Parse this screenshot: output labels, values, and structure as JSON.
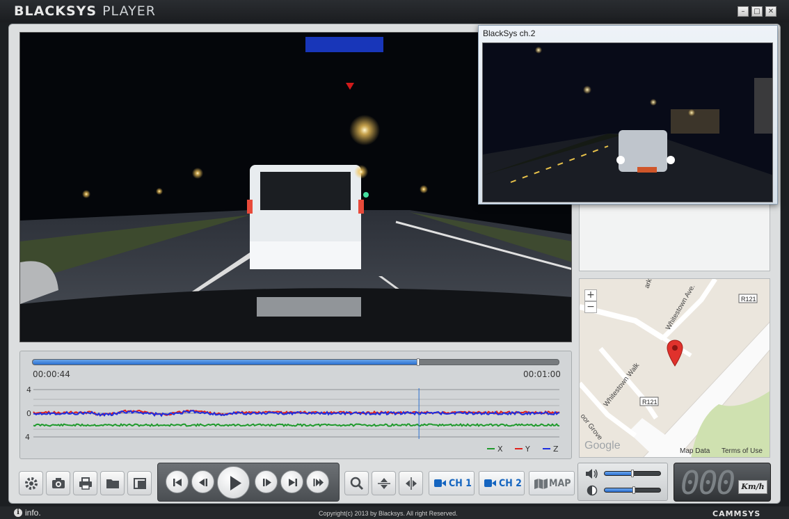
{
  "app": {
    "title_bold": "BLACKSYS",
    "title_light": "PLAYER",
    "window_controls": {
      "minimize": "–",
      "maximize": "□",
      "close": "✕"
    }
  },
  "ch2_window": {
    "title": "BlackSys ch.2"
  },
  "map": {
    "zoom_in": "+",
    "zoom_out": "−",
    "labels": [
      "Whitestown Ave.",
      "Whitestown Walk",
      "R121",
      "R121",
      "ark",
      "oor Grove"
    ],
    "logo": "Google",
    "map_data": "Map Data",
    "terms": "Terms of Use",
    "pin_color": "#e0322c"
  },
  "playback": {
    "current_time": "00:00:44",
    "total_time": "00:01:00",
    "progress": 0.733
  },
  "gsensor": {
    "y_ticks": [
      "4",
      "0",
      "-4"
    ],
    "legend": [
      {
        "name": "X",
        "color": "#1f9a2c"
      },
      {
        "name": "Y",
        "color": "#e0201c"
      },
      {
        "name": "Z",
        "color": "#1e2ee0"
      }
    ]
  },
  "toolbar": {
    "left_icons": [
      "settings-icon",
      "camera-icon",
      "print-icon",
      "folder-icon",
      "window-icon"
    ],
    "player_icons": [
      "skip-previous-icon",
      "step-back-icon",
      "play-icon",
      "step-forward-icon",
      "skip-next-icon",
      "fast-forward-icon"
    ],
    "zoom_icons": [
      "search-icon",
      "flip-vertical-icon",
      "flip-horizontal-icon"
    ],
    "ch1_label": "CH 1",
    "ch2_label": "CH 2",
    "map_label": "MAP",
    "accent_color": "#1565c0"
  },
  "audio": {
    "volume": 0.5,
    "brightness": 0.52
  },
  "speed": {
    "value": "000",
    "unit": "Km/h"
  },
  "status": {
    "info": "info.",
    "copyright": "Copyright(c) 2013 by Blacksys.  All right Reserved.",
    "brand": "CAMMSYS"
  }
}
